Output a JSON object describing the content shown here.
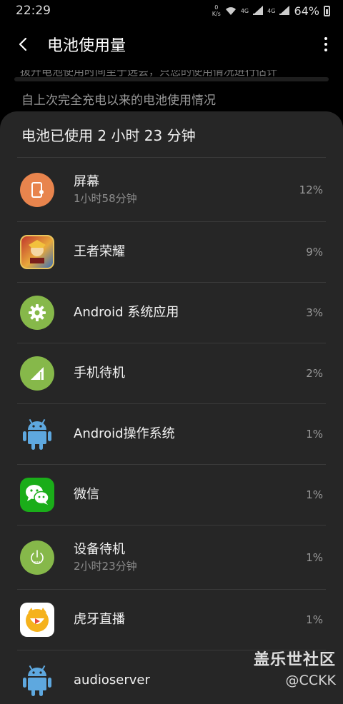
{
  "status": {
    "time": "22:29",
    "net_speed_value": "0",
    "net_speed_unit": "K/s",
    "signal_label_1": "4G",
    "signal_label_2": "4G",
    "battery_percent": "64%"
  },
  "appbar": {
    "title": "电池使用量"
  },
  "clipped_hint": "拔开电池使用时间至于选会，只您的使用情况进行估计",
  "section_label": "自上次完全充电以来的电池使用情况",
  "card": {
    "title": "电池已使用 2 小时 23 分钟",
    "items": [
      {
        "name": "屏幕",
        "sub": "1小时58分钟",
        "percent": "12%",
        "icon": "screen-icon",
        "color": "#E8844D"
      },
      {
        "name": "王者荣耀",
        "sub": "",
        "percent": "9%",
        "icon": "honor-of-kings-icon",
        "color": "#C9902E"
      },
      {
        "name": "Android 系统应用",
        "sub": "",
        "percent": "3%",
        "icon": "gear-icon",
        "color": "#86B84A"
      },
      {
        "name": "手机待机",
        "sub": "",
        "percent": "2%",
        "icon": "cell-signal-icon",
        "color": "#86B84A"
      },
      {
        "name": "Android操作系统",
        "sub": "",
        "percent": "1%",
        "icon": "android-icon",
        "color": "#5EA8DF"
      },
      {
        "name": "微信",
        "sub": "",
        "percent": "1%",
        "icon": "wechat-icon",
        "color": "#1AAD19"
      },
      {
        "name": "设备待机",
        "sub": "2小时23分钟",
        "percent": "1%",
        "icon": "power-icon",
        "color": "#86B84A"
      },
      {
        "name": "虎牙直播",
        "sub": "",
        "percent": "1%",
        "icon": "huya-icon",
        "color": "#F5B21C"
      },
      {
        "name": "audioserver",
        "sub": "",
        "percent": "",
        "icon": "android-icon",
        "color": "#5EA8DF"
      }
    ]
  },
  "watermark": {
    "line1": "盖乐世社区",
    "line2": "@CCKK"
  }
}
